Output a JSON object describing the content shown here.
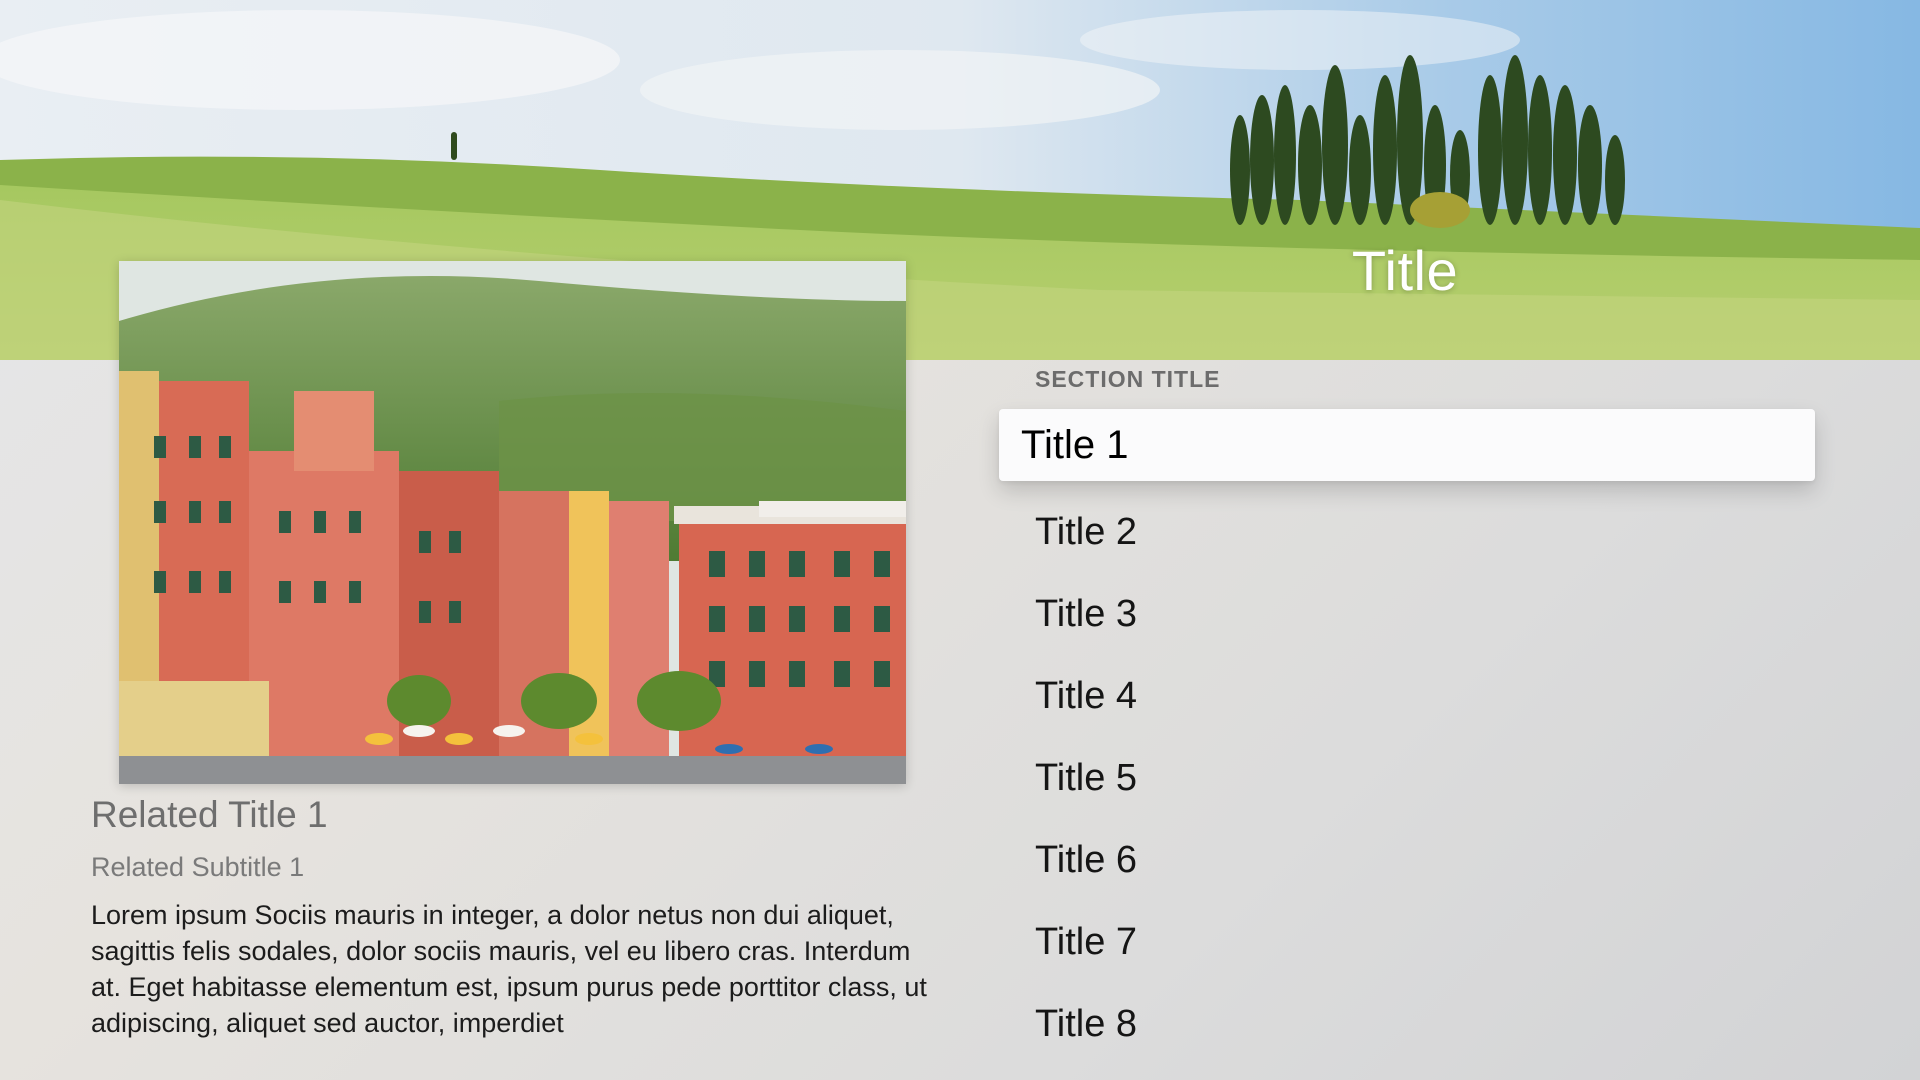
{
  "header": {
    "title": "Title"
  },
  "related": {
    "title": "Related Title 1",
    "subtitle": "Related Subtitle 1",
    "body": "Lorem ipsum Sociis mauris in integer, a dolor netus non dui aliquet, sagittis felis sodales, dolor sociis mauris, vel eu libero cras. Interdum at. Eget habitasse elementum est, ipsum purus pede porttitor class, ut adipiscing, aliquet sed auctor, imperdiet"
  },
  "list": {
    "section_title": "SECTION TITLE",
    "items": [
      {
        "label": "Title 1",
        "focused": true
      },
      {
        "label": "Title 2"
      },
      {
        "label": "Title 3"
      },
      {
        "label": "Title 4"
      },
      {
        "label": "Title 5"
      },
      {
        "label": "Title 6"
      },
      {
        "label": "Title 7"
      },
      {
        "label": "Title 8"
      }
    ]
  },
  "colors": {
    "focus_background": "#fbfbfc",
    "sky": "#cfe2f2",
    "grass": "#9cc04f"
  }
}
